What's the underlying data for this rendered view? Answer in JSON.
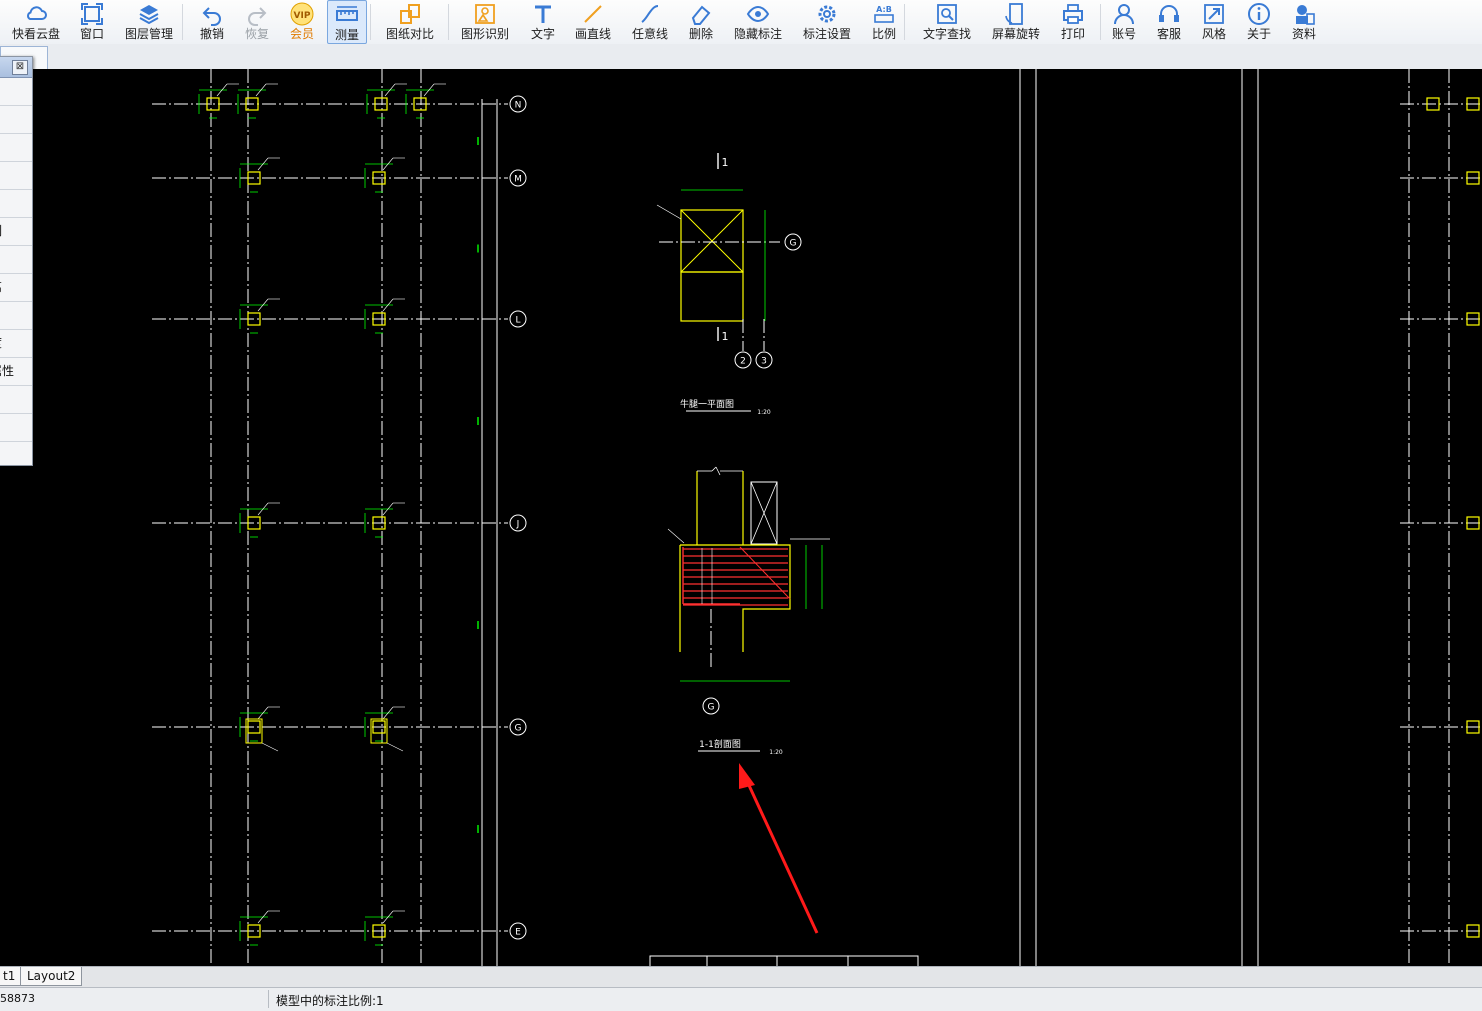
{
  "toolbar": {
    "items": [
      {
        "label": "快看云盘",
        "icon": "cloud-icon"
      },
      {
        "label": "窗口",
        "icon": "window-icon"
      },
      {
        "label": "图层管理",
        "icon": "layers-icon"
      },
      {
        "label": "撤销",
        "icon": "undo-icon"
      },
      {
        "label": "恢复",
        "icon": "redo-icon"
      },
      {
        "label": "会员",
        "icon": "vip-icon"
      },
      {
        "label": "测量",
        "icon": "measure-icon"
      },
      {
        "label": "图纸对比",
        "icon": "compare-icon"
      },
      {
        "label": "图形识别",
        "icon": "shape-recognition-icon"
      },
      {
        "label": "文字",
        "icon": "text-icon"
      },
      {
        "label": "画直线",
        "icon": "line-icon"
      },
      {
        "label": "任意线",
        "icon": "freehand-icon"
      },
      {
        "label": "删除",
        "icon": "eraser-icon"
      },
      {
        "label": "隐藏标注",
        "icon": "eye-icon"
      },
      {
        "label": "标注设置",
        "icon": "annotation-settings-icon"
      },
      {
        "label": "比例",
        "icon": "scale-icon"
      },
      {
        "label": "文字查找",
        "icon": "text-search-icon"
      },
      {
        "label": "屏幕旋转",
        "icon": "rotate-screen-icon"
      },
      {
        "label": "打印",
        "icon": "printer-icon"
      },
      {
        "label": "账号",
        "icon": "user-icon"
      },
      {
        "label": "客服",
        "icon": "headset-icon"
      },
      {
        "label": "风格",
        "icon": "style-icon"
      },
      {
        "label": "关于",
        "icon": "info-icon"
      },
      {
        "label": "资料",
        "icon": "docs-icon"
      }
    ],
    "vip_badge": "VIP",
    "active": "测量",
    "disabled": [
      "恢复"
    ],
    "colors": {
      "icon": "#3a7bd5",
      "vip": "#e07b00",
      "disabled": "#9aa0a6",
      "active_bg": "#dbe9fb"
    }
  },
  "side_panel": {
    "close_glyph": "⊠",
    "rows": [
      "",
      "",
      "",
      "",
      "",
      "列",
      "",
      "离",
      "",
      "度",
      "属性",
      ")",
      ""
    ]
  },
  "drawing": {
    "axis_labels": [
      "N",
      "M",
      "L",
      "J",
      "G",
      "E"
    ],
    "section_markers": [
      "1",
      "1"
    ],
    "plan_axis": "G",
    "plan_bottom_axes": [
      "2",
      "3"
    ],
    "plan_title": "牛腿一平面图",
    "plan_scale": "1:20",
    "section_title": "1-1剖面图",
    "section_scale": "1:20",
    "section_axis": "G",
    "colors": {
      "background": "#000000",
      "gridline": "#ffffff",
      "column": "#ffff00",
      "dimension": "#00ff00",
      "rebar": "#ff3030",
      "arrow": "#ff1a1a"
    }
  },
  "layout_tabs": [
    "t1",
    "Layout2"
  ],
  "status": {
    "coord": "58873",
    "scale_text": "模型中的标注比例:1"
  }
}
